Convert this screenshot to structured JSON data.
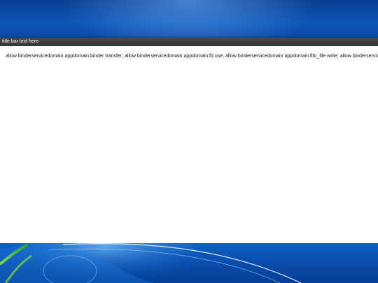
{
  "window": {
    "title": "title bar text here",
    "content_text": "allow binderservicedomain appdomain:binder transfer; allow binderservicedomain appdomain:fd use; allow binderservicedomain appdomain:fifo_file write; allow binderservicedomain"
  },
  "colors": {
    "desktop_blue": "#0b56b8",
    "titlebar": "#333333",
    "window_bg": "#ffffff"
  }
}
